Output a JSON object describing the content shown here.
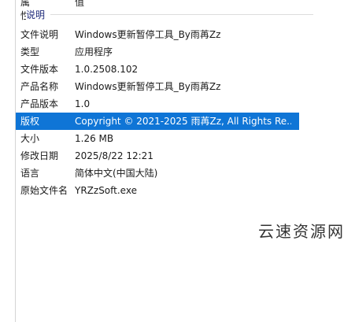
{
  "top_row": {
    "key": "属性",
    "value": "值"
  },
  "section": {
    "title": "说明"
  },
  "rows": [
    {
      "key": "文件说明",
      "value": "Windows更新暂停工具_By雨苒Zz"
    },
    {
      "key": "类型",
      "value": "应用程序"
    },
    {
      "key": "文件版本",
      "value": "1.0.2508.102"
    },
    {
      "key": "产品名称",
      "value": "Windows更新暂停工具_By雨苒Zz"
    },
    {
      "key": "产品版本",
      "value": "1.0"
    },
    {
      "key": "版权",
      "value": "Copyright © 2021-2025 雨苒Zz, All Rights Re..."
    },
    {
      "key": "大小",
      "value": "1.26 MB"
    },
    {
      "key": "修改日期",
      "value": "2025/8/22 12:21"
    },
    {
      "key": "语言",
      "value": "简体中文(中国大陆)"
    },
    {
      "key": "原始文件名",
      "value": "YRZzSoft.exe"
    }
  ],
  "selected_row_index": 5,
  "colors": {
    "selection": "#0f75d6",
    "section_title": "#1e2a7a"
  },
  "watermark": "云速资源网"
}
